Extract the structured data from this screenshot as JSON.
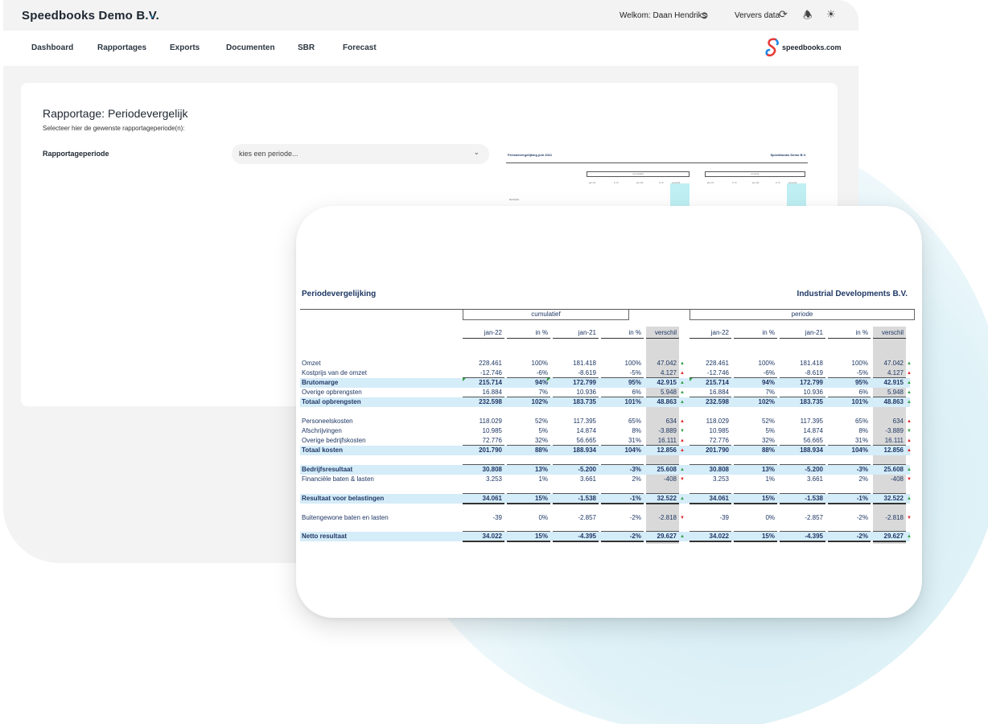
{
  "header": {
    "company": "Speedbooks Demo B.V.",
    "welcome": "Welkom: Daan Hendriks",
    "refresh_label": "Ververs data"
  },
  "nav": {
    "items": [
      "Dashboard",
      "Rapportages",
      "Exports",
      "Documenten",
      "SBR",
      "Forecast"
    ],
    "logo_text": "speedbooks.com"
  },
  "page": {
    "title": "Rapportage: Periodevergelijk",
    "subtitle": "Selecteer hier de gewenste rapportageperiode(n):",
    "field_label": "Rapportageperiode",
    "select_placeholder": "kies een periode..."
  },
  "preview": {
    "title": "Periodevergelijking juni 2021",
    "company": "Speedbooks Demo B.V.",
    "group1": "cumulatief",
    "group2": "periode",
    "cols": [
      "jan-21",
      "in %",
      "jun-20",
      "in %",
      "verschil"
    ],
    "first_row": "Bedrijfsle"
  },
  "report": {
    "title": "Periodevergelijking",
    "company": "Industrial Developments B.V.",
    "groups": [
      "cumulatief",
      "periode"
    ],
    "columns": [
      "jan-22",
      "in %",
      "jan-21",
      "in %",
      "verschil"
    ],
    "rows": [
      {
        "label": "Omzet",
        "values": [
          "228.461",
          "100%",
          "181.418",
          "100%",
          "47.042"
        ],
        "dir": "up",
        "bold": false,
        "blue": false
      },
      {
        "label": "Kostprijs van de omzet",
        "values": [
          "-12.746",
          "-6%",
          "-8.619",
          "-5%",
          "4.127"
        ],
        "dir": "down",
        "bold": false,
        "blue": false
      },
      {
        "label": "Brutomarge",
        "values": [
          "215.714",
          "94%",
          "172.799",
          "95%",
          "42.915"
        ],
        "dir": "up",
        "bold": true,
        "blue": true
      },
      {
        "label": "Overige opbrengsten",
        "values": [
          "16.884",
          "7%",
          "10.936",
          "6%",
          "5.948"
        ],
        "dir": "up",
        "bold": false,
        "blue": false
      },
      {
        "label": "Totaal opbrengsten",
        "values": [
          "232.598",
          "102%",
          "183.735",
          "101%",
          "48.863"
        ],
        "dir": "up",
        "bold": true,
        "blue": true
      },
      {
        "label": "Personeelskosten",
        "values": [
          "118.029",
          "52%",
          "117.395",
          "65%",
          "634"
        ],
        "dir": "down",
        "bold": false,
        "blue": false
      },
      {
        "label": "Afschrijvingen",
        "values": [
          "10.985",
          "5%",
          "14.874",
          "8%",
          "-3.889"
        ],
        "dir": "downgreen",
        "bold": false,
        "blue": false
      },
      {
        "label": "Overige bedrijfskosten",
        "values": [
          "72.776",
          "32%",
          "56.665",
          "31%",
          "16.111"
        ],
        "dir": "down",
        "bold": false,
        "blue": false
      },
      {
        "label": "Totaal kosten",
        "values": [
          "201.790",
          "88%",
          "188.934",
          "104%",
          "12.856"
        ],
        "dir": "down",
        "bold": true,
        "blue": true
      },
      {
        "label": "Bedrijfsresultaat",
        "values": [
          "30.808",
          "13%",
          "-5.200",
          "-3%",
          "25.608"
        ],
        "dir": "up",
        "bold": true,
        "blue": true
      },
      {
        "label": "Financiële baten & lasten",
        "values": [
          "3.253",
          "1%",
          "3.661",
          "2%",
          "-408"
        ],
        "dir": "downred",
        "bold": false,
        "blue": false
      },
      {
        "label": "Resultaat voor belastingen",
        "values": [
          "34.061",
          "15%",
          "-1.538",
          "-1%",
          "32.522"
        ],
        "dir": "up",
        "bold": true,
        "blue": true
      },
      {
        "label": "Buitengewone baten en lasten",
        "values": [
          "-39",
          "0%",
          "-2.857",
          "-2%",
          "-2.818"
        ],
        "dir": "downred",
        "bold": false,
        "blue": false
      },
      {
        "label": "Netto resultaat",
        "values": [
          "34.022",
          "15%",
          "-4.395",
          "-2%",
          "29.627"
        ],
        "dir": "up",
        "bold": true,
        "blue": true
      }
    ]
  },
  "colors": {
    "accent": "#2196c9",
    "report_text": "#1f3864",
    "highlight_row": "#d5ecf9",
    "diff_column": "#d9d9d9",
    "arrow_up": "#2ea043",
    "arrow_down": "#e0262a"
  }
}
